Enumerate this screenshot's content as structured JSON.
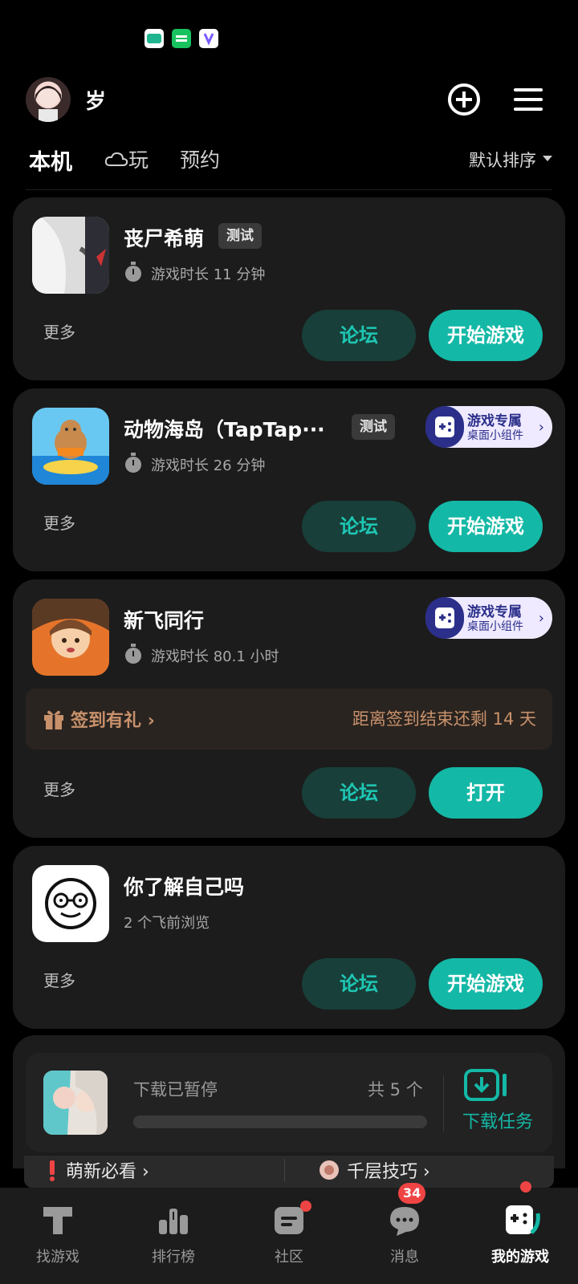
{
  "status_bar": {
    "apps": [
      {
        "icon": "deyi-app-icon",
        "color": "#1fb58f"
      },
      {
        "icon": "iqiyi-app-icon",
        "color": "#18c25f"
      },
      {
        "icon": "app-store-icon",
        "color": "#ffffff"
      }
    ]
  },
  "header": {
    "username": "岁",
    "add_icon": "plus-circle-icon",
    "menu_icon": "hamburger-menu-icon"
  },
  "tabs": {
    "items": [
      "本机",
      "玩",
      "预约"
    ],
    "active": "本机",
    "cloud_icon": "cloud-icon",
    "sort_label": "默认排序"
  },
  "labels": {
    "more": "更多",
    "forum": "论坛",
    "play": "开始游戏",
    "open": "打开",
    "test_badge": "测试",
    "widget_title": "游戏专属",
    "widget_sub": "桌面小组件",
    "widget_chevron": "›"
  },
  "games": [
    {
      "title": "丧尸希萌",
      "badge": "测试",
      "playtime": "游戏时长 11 分钟",
      "action": "开始游戏"
    },
    {
      "title": "动物海岛（TapTap···",
      "badge": "测试",
      "playtime": "游戏时长 26 分钟",
      "action": "开始游戏",
      "widget": true
    },
    {
      "title": "新飞同行",
      "playtime": "游戏时长 80.1 小时",
      "action": "打开",
      "widget": true,
      "signin": {
        "label": "签到有礼",
        "chevron": "›",
        "remaining": "距离签到结束还剩 14 天"
      }
    },
    {
      "title": "你了解自己吗",
      "playtime": "2 个飞前浏览",
      "action": "开始游戏"
    }
  ],
  "download": {
    "status": "下载已暂停",
    "count": "共 5 个",
    "progress": 0.0,
    "task_label": "下载任务",
    "task_icon": "download-task-icon"
  },
  "quick_links": [
    {
      "label": "萌新必看 ›",
      "icon": "exclamation-icon"
    },
    {
      "label": "千层技巧 ›",
      "icon": "gear-badge-icon"
    }
  ],
  "bottom_nav": {
    "items": [
      {
        "label": "找游戏",
        "icon": "taptap-logo-icon"
      },
      {
        "label": "排行榜",
        "icon": "leaderboard-icon"
      },
      {
        "label": "社区",
        "icon": "community-icon",
        "dot": true
      },
      {
        "label": "消息",
        "icon": "message-icon",
        "badge": "34"
      },
      {
        "label": "我的游戏",
        "icon": "gamepad-icon",
        "dot": true,
        "active": true
      }
    ]
  },
  "colors": {
    "accent": "#14b8a6",
    "forum_bg": "#183f39",
    "card_bg": "#1c1c1c",
    "badge_red": "#ef4444",
    "signin_text": "#c8916b",
    "widget_bg": "#efeaff"
  }
}
